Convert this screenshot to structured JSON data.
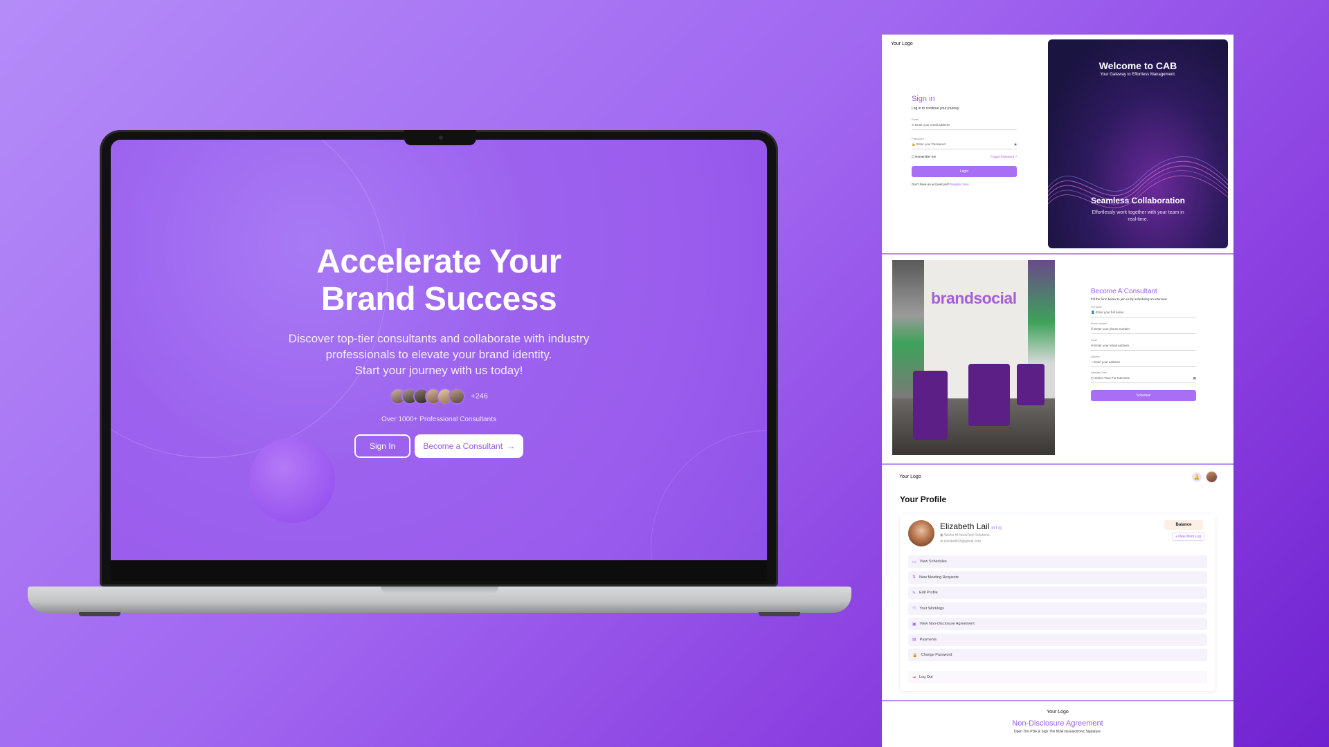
{
  "hero": {
    "title_line1": "Accelerate Your",
    "title_line2": "Brand Success",
    "subtitle_line1": "Discover top-tier consultants and collaborate with industry",
    "subtitle_line2": "professionals to elevate your brand identity.",
    "subtitle_line3": "Start your journey with us today!",
    "avatar_more": "+246",
    "consultant_count": "Over 1000+ Professional Consultants",
    "signin_button": "Sign In",
    "consultant_button": "Become a Consultant"
  },
  "signin": {
    "logo": "Your Logo",
    "heading": "Sign in",
    "subheading": "Log in to continue your journey.",
    "email_label": "Email",
    "email_placeholder": "Enter your email address",
    "password_label": "Password",
    "password_placeholder": "Enter your Password",
    "remember": "Remember me",
    "forgot": "Forgot Password ?",
    "login_button": "Login",
    "no_account": "Don't have an account yet?",
    "register": "Register Now",
    "welcome_title": "Welcome to CAB",
    "welcome_sub": "Your Gateway to Effortless Management.",
    "collab_title": "Seamless Collaboration",
    "collab_text": "Effortlessly work together with your team in real-time."
  },
  "consultant": {
    "brand_sign": "brandsocial",
    "heading": "Become A Consultant",
    "subheading": "Fill the form below to join us by scheduling an interview.",
    "fields": [
      {
        "label": "Full Name",
        "placeholder": "Enter your full name"
      },
      {
        "label": "Phone Number",
        "placeholder": "Enter your phone number"
      },
      {
        "label": "Email",
        "placeholder": "Enter your email address"
      },
      {
        "label": "Address",
        "placeholder": "Enter your address"
      },
      {
        "label": "Interview Time",
        "placeholder": "Select Time For Interview"
      }
    ],
    "schedule_button": "Schedule"
  },
  "profile": {
    "logo": "Your Logo",
    "title": "Your Profile",
    "name": "Elizabeth Lail",
    "socials": "in f ◎",
    "works_at": "Works At NovaTech Solutions",
    "email": "elizabeth18@gmail.com",
    "balance": "Balance",
    "new_work_log": "+ New Work Log",
    "menu": [
      {
        "icon": "▭",
        "label": "View Schedules"
      },
      {
        "icon": "⇅",
        "label": "New Meeting Requests"
      },
      {
        "icon": "✎",
        "label": "Edit Profile"
      },
      {
        "icon": "⚇",
        "label": "Your Worklogs"
      },
      {
        "icon": "▣",
        "label": "View Non-Disclosure Agreement"
      },
      {
        "icon": "▤",
        "label": "Payments"
      },
      {
        "icon": "🔒",
        "label": "Change Password"
      }
    ],
    "logout": "Log Out"
  },
  "nda": {
    "logo": "Your Logo",
    "heading": "Non-Disclosure Agreement",
    "subheading": "Open The PDF & Sign The NDA via Electronic Signature."
  },
  "colors": {
    "accent": "#9a5ced",
    "background_start": "#b48cf8",
    "background_end": "#6f22cf"
  }
}
